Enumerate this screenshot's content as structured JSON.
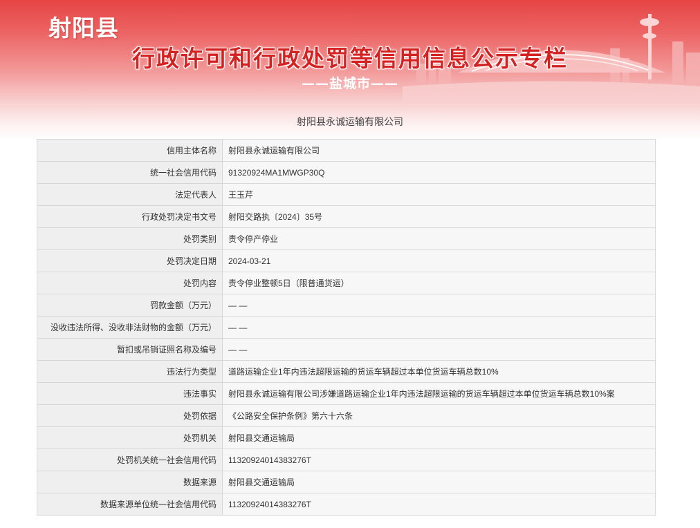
{
  "header": {
    "county": "射阳县",
    "title": "行政许可和行政处罚等信用信息公示专栏",
    "city": "——盐城市——"
  },
  "company_title": "射阳县永诚运输有限公司",
  "rows": [
    {
      "label": "信用主体名称",
      "value": "射阳县永诚运输有限公司"
    },
    {
      "label": "统一社会信用代码",
      "value": "91320924MA1MWGP30Q"
    },
    {
      "label": "法定代表人",
      "value": "王玉芹"
    },
    {
      "label": "行政处罚决定书文号",
      "value": "射阳交路执〔2024〕35号"
    },
    {
      "label": "处罚类别",
      "value": "责令停产停业"
    },
    {
      "label": "处罚决定日期",
      "value": "2024-03-21"
    },
    {
      "label": "处罚内容",
      "value": "责令停业整顿5日（限普通货运）"
    },
    {
      "label": "罚款金额（万元）",
      "value": "— —"
    },
    {
      "label": "没收违法所得、没收非法财物的金额（万元）",
      "value": "— —"
    },
    {
      "label": "暂扣或吊销证照名称及编号",
      "value": "— —"
    },
    {
      "label": "违法行为类型",
      "value": "道路运输企业1年内违法超限运输的货运车辆超过本单位货运车辆总数10%"
    },
    {
      "label": "违法事实",
      "value": "射阳县永诚运输有限公司涉嫌道路运输企业1年内违法超限运输的货运车辆超过本单位货运车辆总数10%案"
    },
    {
      "label": "处罚依据",
      "value": "《公路安全保护条例》第六十六条"
    },
    {
      "label": "处罚机关",
      "value": "射阳县交通运输局"
    },
    {
      "label": "处罚机关统一社会信用代码",
      "value": "11320924014383276T"
    },
    {
      "label": "数据来源",
      "value": "射阳县交通运输局"
    },
    {
      "label": "数据来源单位统一社会信用代码",
      "value": "11320924014383276T"
    }
  ]
}
